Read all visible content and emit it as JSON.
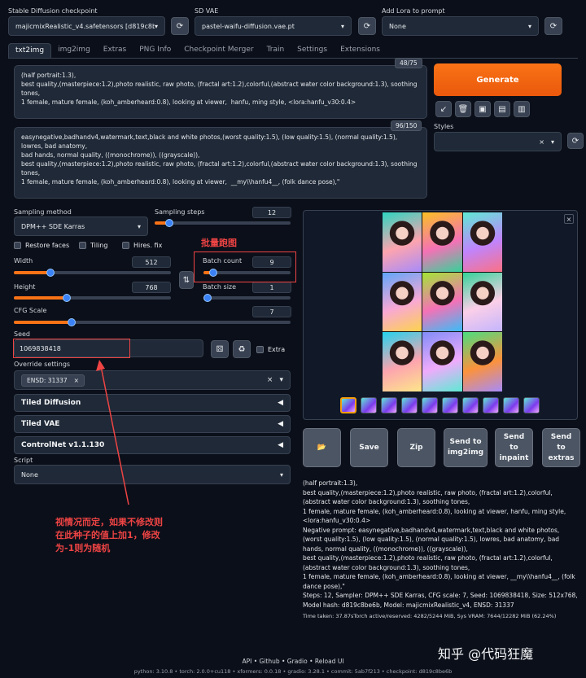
{
  "header": {
    "checkpoint_label": "Stable Diffusion checkpoint",
    "checkpoint_value": "majicmixRealistic_v4.safetensors [d819c8be6b",
    "vae_label": "SD VAE",
    "vae_value": "pastel-waifu-diffusion.vae.pt",
    "lora_label": "Add Lora to prompt",
    "lora_value": "None"
  },
  "tabs": [
    "txt2img",
    "img2img",
    "Extras",
    "PNG Info",
    "Checkpoint Merger",
    "Train",
    "Settings",
    "Extensions"
  ],
  "prompt": {
    "counter": "48/75",
    "text": "(half portrait:1.3),\nbest quality,(masterpiece:1.2),photo realistic, raw photo, (fractal art:1.2),colorful,(abstract water color background:1.3), soothing tones,\n1 female, mature female, (koh_amberheard:0.8), looking at viewer,  hanfu, ming style, <lora:hanfu_v30:0.4>"
  },
  "negative": {
    "counter": "96/150",
    "text": "easynegative,badhandv4,watermark,text,black and white photos,(worst quality:1.5), (low quality:1.5), (normal quality:1.5), lowres, bad anatomy,\nbad hands, normal quality, ((monochrome)), ((grayscale)),\nbest quality,(masterpiece:1.2),photo realistic, raw photo, (fractal art:1.2),colorful,(abstract water color background:1.3), soothing tones,\n1 female, mature female, (koh_amberheard:0.8), looking at viewer,  __my\\\\hanfu4__, (folk dance pose),\""
  },
  "generate_label": "Generate",
  "styles_label": "Styles",
  "tool_icons": [
    "arrow-icon",
    "trash-icon",
    "image-icon",
    "save-style-icon",
    "apply-style-icon"
  ],
  "sampling": {
    "method_label": "Sampling method",
    "method_value": "DPM++ SDE Karras",
    "steps_label": "Sampling steps",
    "steps_value": "12",
    "steps_fraction": 0.08
  },
  "checks": {
    "restore_faces": "Restore faces",
    "tiling": "Tiling",
    "hires_fix": "Hires. fix"
  },
  "size": {
    "width_label": "Width",
    "width_value": "512",
    "width_fraction": 0.22,
    "height_label": "Height",
    "height_value": "768",
    "height_fraction": 0.33,
    "swap_icon": "⇅"
  },
  "batch": {
    "count_label": "Batch count",
    "count_value": "9",
    "count_fraction": 0.07,
    "size_label": "Batch size",
    "size_value": "1",
    "size_fraction": 0.0
  },
  "cfg": {
    "label": "CFG Scale",
    "value": "7",
    "fraction": 0.2
  },
  "seed": {
    "label": "Seed",
    "value": "1069838418",
    "extra_label": "Extra"
  },
  "override": {
    "label": "Override settings",
    "chip": "ENSD: 31337"
  },
  "accordions": [
    "Tiled Diffusion",
    "Tiled VAE",
    "ControlNet v1.1.130"
  ],
  "script": {
    "label": "Script",
    "value": "None"
  },
  "annotations": {
    "batch_note": "批量跑图",
    "seed_note": "视情况而定，如果不修改则\n在此种子的值上加1，修改\n为-1则为随机"
  },
  "actions": {
    "folder_icon": "folder-icon",
    "save": "Save",
    "zip": "Zip",
    "send_img2img": "Send to img2img",
    "send_inpaint": "Send to inpaint",
    "send_extras": "Send to extras"
  },
  "info": {
    "text": "(half portrait:1.3),\nbest quality,(masterpiece:1.2),photo realistic, raw photo, (fractal art:1.2),colorful,(abstract water color background:1.3), soothing tones,\n1 female, mature female, (koh_amberheard:0.8), looking at viewer, hanfu, ming style, <lora:hanfu_v30:0.4>\nNegative prompt: easynegative,badhandv4,watermark,text,black and white photos,(worst quality:1.5), (low quality:1.5), (normal quality:1.5), lowres, bad anatomy, bad hands, normal quality, ((monochrome)), ((grayscale)),\nbest quality,(masterpiece:1.2),photo realistic, raw photo, (fractal art:1.2),colorful,(abstract water color background:1.3), soothing tones,\n1 female, mature female, (koh_amberheard:0.8), looking at viewer, __my\\\\hanfu4__, (folk dance pose),\"\nSteps: 12, Sampler: DPM++ SDE Karras, CFG scale: 7, Seed: 1069838418, Size: 512x768, Model hash: d819c8be6b, Model: majicmixRealistic_v4, ENSD: 31337",
    "time": "Time taken: 37.87sTorch active/reserved: 4282/5244 MiB, Sys VRAM: 7644/12282 MiB (62.24%)"
  },
  "footer": {
    "links": "API  •  Github  •  Gradio  •  Reload UI",
    "versions": "python: 3.10.8  •  torch: 2.0.0+cu118  •  xformers: 0.0.18  •  gradio: 3.28.1  •  commit: 5ab7f213  •  checkpoint: d819c8be6b"
  },
  "watermark": "知乎 @代码狂魔",
  "colors": {
    "accent": "#f97316",
    "annotation": "#ef4444",
    "background": "#0b0f19"
  }
}
